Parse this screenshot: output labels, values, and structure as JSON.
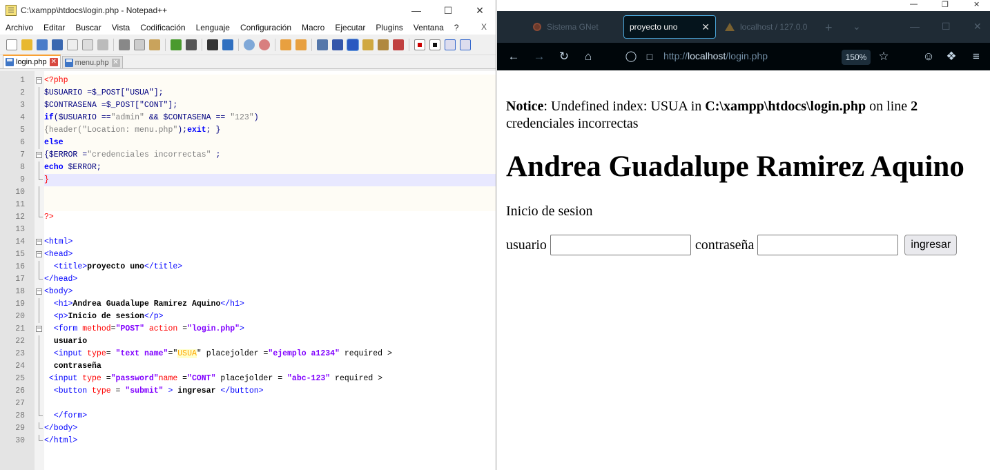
{
  "notepad": {
    "title": "C:\\xampp\\htdocs\\login.php - Notepad++",
    "menu": [
      "Archivo",
      "Editar",
      "Buscar",
      "Vista",
      "Codificación",
      "Lenguaje",
      "Configuración",
      "Macro",
      "Ejecutar",
      "Plugins",
      "Ventana",
      "?"
    ],
    "menu_close": "X",
    "tabs": [
      {
        "label": "login.php",
        "active": true
      },
      {
        "label": "menu.php",
        "active": false
      }
    ]
  },
  "code_lines": [
    "1",
    "2",
    "3",
    "4",
    "5",
    "6",
    "7",
    "8",
    "9",
    "10",
    "11",
    "12",
    "13",
    "14",
    "15",
    "16",
    "17",
    "18",
    "19",
    "20",
    "21",
    "22",
    "23",
    "24",
    "25",
    "26",
    "27",
    "28",
    "29",
    "30"
  ],
  "code": {
    "l1": "<?php",
    "l2": "$USUARIO =$_POST[\"USUA\"];",
    "l3": "$CONTRASENA =$_POST[\"CONT\"];",
    "l4a": "if",
    "l4b": "($USUARIO ==",
    "l4c": "\"admin\"",
    "l4d": " && $CONTASENA == ",
    "l4e": "\"123\"",
    "l4f": ")",
    "l5a": "{header(",
    "l5b": "\"Location: menu.php\"",
    "l5c": ");",
    "l5d": "exit",
    "l5e": "; }",
    "l6": "else",
    "l7a": "{$ERROR =",
    "l7b": "\"credenciales incorrectas\"",
    "l7c": " ;",
    "l8a": "echo",
    "l8b": " $ERROR;",
    "l9": "}",
    "l12": "?>",
    "l14": "<html>",
    "l15": "<head>",
    "l16a": "<title>",
    "l16b": "proyecto uno",
    "l16c": "</title>",
    "l17": "</head>",
    "l18": "<body>",
    "l19a": "<h1>",
    "l19b": "Andrea Guadalupe Ramirez Aquino",
    "l19c": "</h1>",
    "l20a": "<p>",
    "l20b": "Inicio de sesion",
    "l20c": "</p>",
    "l21a": "<form ",
    "l21b": "method",
    "l21c": "=",
    "l21d": "\"POST\"",
    "l21e": " action ",
    "l21f": "=",
    "l21g": "\"login.php\"",
    "l21h": ">",
    "l22": "usuario",
    "l23a": "<input ",
    "l23b": "type",
    "l23c": "= ",
    "l23d": "\"text name\"",
    "l23e": "=\"",
    "l23f": "USUA",
    "l23g": "\" placejolder =",
    "l23h": "\"ejemplo a1234\"",
    "l23i": " required >",
    "l24": "contraseña",
    "l25a": "<input ",
    "l25b": "type",
    "l25c": " =",
    "l25d": "\"password\"",
    "l25e": "name",
    "l25f": " =",
    "l25g": "\"CONT\"",
    "l25h": " placejolder = ",
    "l25i": "\"abc-123\"",
    "l25j": " required >",
    "l26a": "<button ",
    "l26b": "type",
    "l26c": " = ",
    "l26d": "\"submit\"",
    "l26e": " > ",
    "l26f": "ingresar",
    "l26g": " </button>",
    "l28": "</form>",
    "l29": "</body>",
    "l30": "</html>"
  },
  "browser": {
    "tabs": [
      {
        "label": "Sistema GNet"
      },
      {
        "label": "proyecto uno"
      },
      {
        "label": "localhost / 127.0.0"
      }
    ],
    "url_prefix": "http://",
    "url_host": "localhost",
    "url_path": "/login.php",
    "zoom": "150%"
  },
  "page": {
    "notice_label": "Notice",
    "notice_text1": ": Undefined index: USUA in ",
    "notice_file": "C:\\xampp\\htdocs\\login.php",
    "notice_text2": " on line ",
    "notice_line": "2",
    "error_text": "credenciales incorrectas",
    "h1": "Andrea Guadalupe Ramirez Aquino",
    "subtitle": "Inicio de sesion",
    "user_label": "usuario",
    "pass_label": "contraseña",
    "submit_label": "ingresar"
  }
}
